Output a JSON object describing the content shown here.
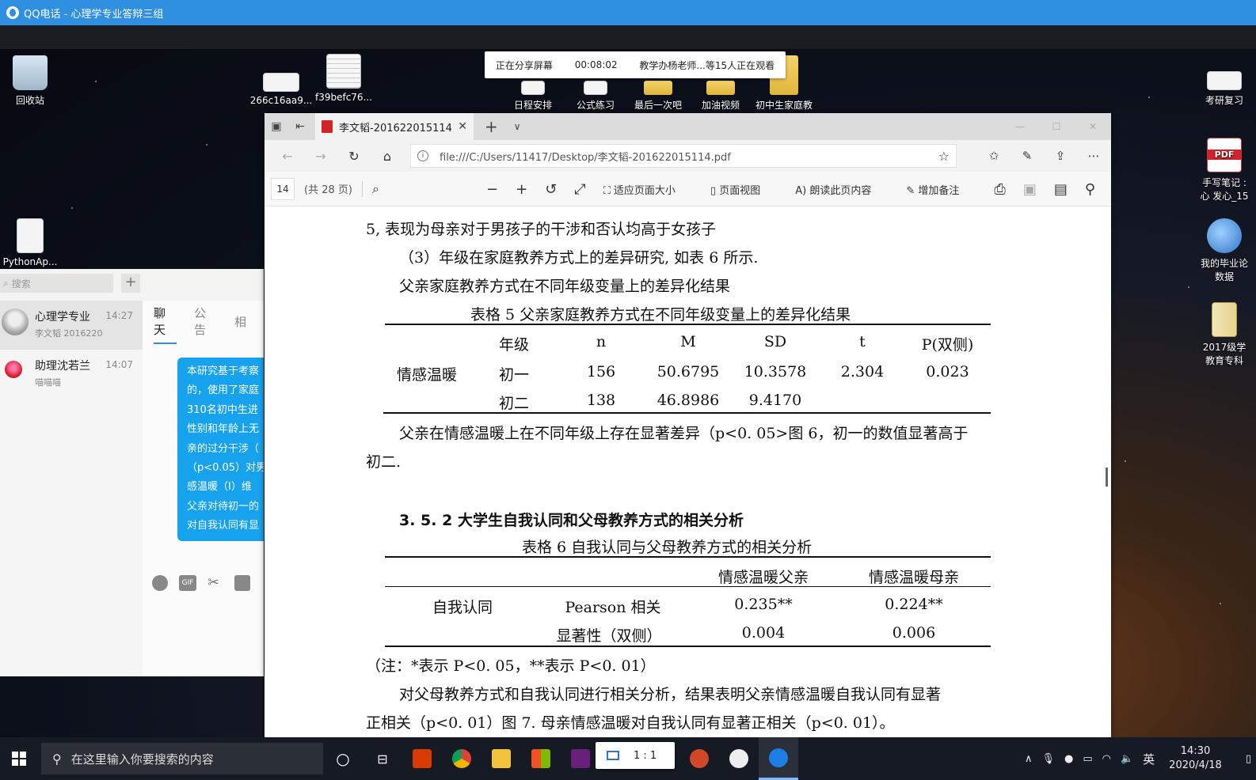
{
  "qq_window": {
    "title": "QQ电话 - 心理学专业答辩三组"
  },
  "share_banner": {
    "status": "正在分享屏幕",
    "timer": "00:08:02",
    "viewers": "教学办杨老师...等15人正在观看"
  },
  "desktop_icons": {
    "recycle": "回收站",
    "file1": "266c16aa9...",
    "file2": "f39befc76...",
    "schedule": "日程安排",
    "formula": "公式练习",
    "last": "最后一次吧",
    "video": "加油视频",
    "junior": "初中生家庭教",
    "kaoyan": "考研复习",
    "python": "PythonAp...",
    "notes1": "手写笔记 :",
    "notes2": "心 发心_15",
    "thesis1": "我的毕业论",
    "thesis2": "数据",
    "edu1": "2017级学",
    "edu2": "教育专科"
  },
  "qq_chat": {
    "search_placeholder": "搜索",
    "add": "+",
    "contacts": [
      {
        "name": "心理学专业",
        "time": "14:27",
        "msg": "李文韬 2016220"
      },
      {
        "name": "助理沈若兰",
        "time": "14:07",
        "msg": "喵喵喵"
      }
    ],
    "tabs": [
      "聊天",
      "公告",
      "相"
    ],
    "bubble_lines": [
      "本研究基于考察",
      "的，使用了家庭",
      "310名初中生进",
      "性别和年龄上无",
      "亲的过分干涉（",
      "（p<0.05）对男",
      "感温暖（I）维",
      "父亲对待初一的",
      "对自我认同有显"
    ],
    "gif": "GIF"
  },
  "browser": {
    "tab_title": "李文韬-201622015114.pdf",
    "url": "file:///C:/Users/11417/Desktop/李文韬-201622015114.pdf",
    "page_number": "14",
    "page_total": "(共 28 页)",
    "tools": {
      "fit": "适应页面大小",
      "page_view": "页面视图",
      "read_aloud": "朗读此页内容",
      "add_notes": "增加备注"
    }
  },
  "pdf": {
    "line1": "5, 表现为母亲对于男孩子的干涉和否认均高于女孩子",
    "line2": "（3）年级在家庭教养方式上的差异研究, 如表 6 所示.",
    "line3": "父亲家庭教养方式在不同年级变量上的差异化结果",
    "table5_caption": "表格  5  父亲家庭教养方式在不同年级变量上的差异化结果",
    "table5": {
      "headers": [
        "年级",
        "n",
        "M",
        "SD",
        "t",
        "P(双侧)"
      ],
      "row_label": "情感温暖",
      "rows": [
        [
          "初一",
          "156",
          "50.6795",
          "10.3578",
          "2.304",
          "0.023"
        ],
        [
          "初二",
          "138",
          "46.8986",
          "9.4170",
          "",
          ""
        ]
      ]
    },
    "para1a": "父亲在情感温暖上在不同年级上存在显著差异（p<0. 05>图 6，初一的数值显著高于",
    "para1b": "初二.",
    "heading_352": "3. 5. 2 大学生自我认同和父母教养方式的相关分析",
    "table6_caption": "表格  6  自我认同与父母教养方式的相关分析",
    "table6": {
      "headers": [
        "情感温暖父亲",
        "情感温暖母亲"
      ],
      "row_label": "自我认同",
      "rows": [
        [
          "Pearson 相关",
          "0.235**",
          "0.224**"
        ],
        [
          "显著性（双侧）",
          "0.004",
          "0.006"
        ]
      ]
    },
    "note": "（注：*表示 P<0. 05，**表示 P<0. 01）",
    "para2a": "对父母教养方式和自我认同进行相关分析，结果表明父亲情感温暖自我认同有显著",
    "para2b": "正相关（p<0. 01）图 7. 母亲情感温暖对自我认同有显著正相关（p<0. 01）。"
  },
  "taskbar": {
    "search_placeholder": "在这里输入你要搜索的内容",
    "ime": "英",
    "time": "14:30",
    "date": "2020/4/18",
    "ratio": "1 : 1"
  }
}
